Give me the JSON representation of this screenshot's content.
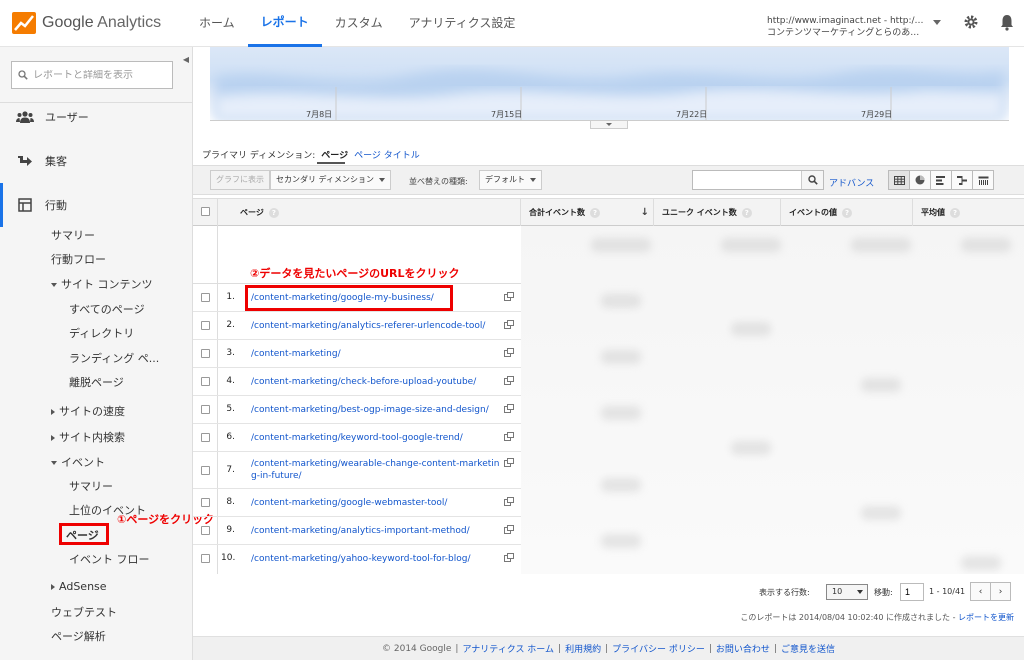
{
  "header": {
    "logo_google": "Google",
    "logo_analytics": "Analytics",
    "nav": [
      {
        "label": "ホーム",
        "active": false
      },
      {
        "label": "レポート",
        "active": true
      },
      {
        "label": "カスタム",
        "active": false
      },
      {
        "label": "アナリティクス設定",
        "active": false
      }
    ],
    "account_url": "http://www.imaginact.net - http://www.i...",
    "account_name": "コンテンツマーケティングとらのあな..."
  },
  "sidebar": {
    "search_placeholder": "レポートと詳細を表示",
    "users": "ユーザー",
    "acquisition": "集客",
    "behavior": "行動",
    "items": {
      "summary": "サマリー",
      "flow": "行動フロー",
      "site_content": "サイト コンテンツ",
      "all_pages": "すべてのページ",
      "directory": "ディレクトリ",
      "landing": "ランディング ペ...",
      "exit_pages": "離脱ページ",
      "site_speed": "サイトの速度",
      "site_search": "サイト内検索",
      "events": "イベント",
      "events_summary": "サマリー",
      "top_events": "上位のイベント",
      "pages": "ページ",
      "event_flow": "イベント フロー",
      "adsense": "AdSense",
      "web_test": "ウェブテスト",
      "page_analysis": "ページ解析"
    },
    "annotation": "①ページをクリック"
  },
  "chart": {
    "x_labels": [
      "7月8日",
      "7月15日",
      "7月22日",
      "7月29日"
    ]
  },
  "dimension": {
    "label": "プライマリ ディメンション:",
    "current": "ページ",
    "alt": "ページ タイトル"
  },
  "toolbar": {
    "graph_btn": "グラフに表示",
    "secondary_dim": "セカンダリ ディメンション",
    "sort_label": "並べ替えの種類:",
    "sort_value": "デフォルト",
    "advanced": "アドバンス"
  },
  "table": {
    "headers": {
      "page": "ページ",
      "total_events": "合計イベント数",
      "unique_events": "ユニーク イベント数",
      "event_value": "イベントの値",
      "avg_value": "平均値"
    },
    "rows": [
      {
        "num": "1.",
        "url": "/content-marketing/google-my-business/"
      },
      {
        "num": "2.",
        "url": "/content-marketing/analytics-referer-urlencode-tool/"
      },
      {
        "num": "3.",
        "url": "/content-marketing/"
      },
      {
        "num": "4.",
        "url": "/content-marketing/check-before-upload-youtube/"
      },
      {
        "num": "5.",
        "url": "/content-marketing/best-ogp-image-size-and-design/"
      },
      {
        "num": "6.",
        "url": "/content-marketing/keyword-tool-google-trend/"
      },
      {
        "num": "7.",
        "url": "/content-marketing/wearable-change-content-marketing-in-future/"
      },
      {
        "num": "8.",
        "url": "/content-marketing/google-webmaster-tool/"
      },
      {
        "num": "9.",
        "url": "/content-marketing/analytics-important-method/"
      },
      {
        "num": "10.",
        "url": "/content-marketing/yahoo-keyword-tool-for-blog/"
      }
    ],
    "annotation": "②データを見たいページのURLをクリック"
  },
  "pager": {
    "rows_label": "表示する行数:",
    "rows_value": "10",
    "goto_label": "移動:",
    "goto_value": "1",
    "range": "1 - 10/41"
  },
  "created": {
    "text": "このレポートは 2014/08/04 10:02:40 に作成されました - ",
    "refresh": "レポートを更新"
  },
  "footer": {
    "copyright": "© 2014 Google",
    "links": [
      "アナリティクス ホーム",
      "利用規約",
      "プライバシー ポリシー",
      "お問い合わせ",
      "ご意見を送信"
    ]
  },
  "colors": {
    "accent": "#1a73e8",
    "link": "#1155cc",
    "annotation": "#ee0000",
    "logo": "#f57c00"
  }
}
